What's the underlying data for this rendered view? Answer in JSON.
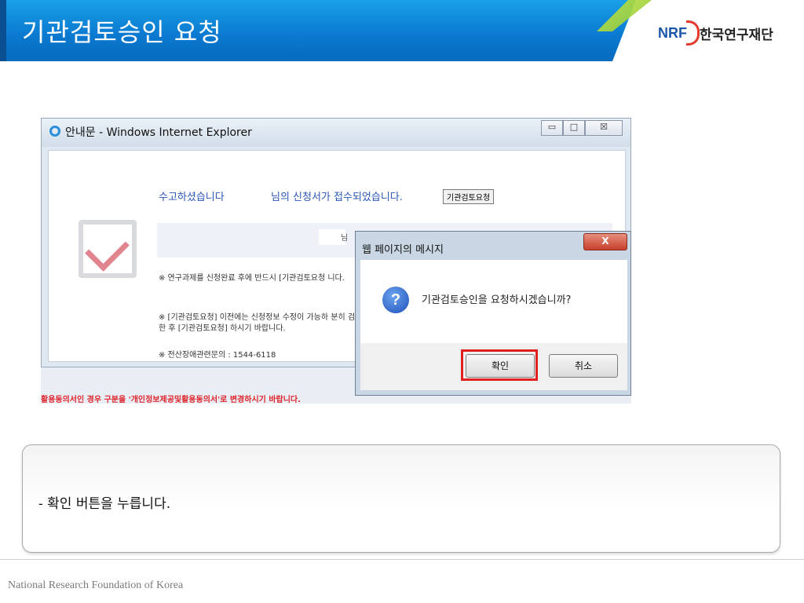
{
  "slide": {
    "title": "기관검토승인 요청",
    "logo": {
      "abbr": "NRF",
      "name": "한국연구재단"
    },
    "caption": "- 확인 버튼을 누릅니다.",
    "footer": "National Research Foundation of Korea"
  },
  "browser": {
    "window_title": "안내문 - Windows Internet Explorer",
    "controls": {
      "minimize": "▭",
      "maximize": "□",
      "close": "☒"
    },
    "content": {
      "thanks": "수고하셨습니다",
      "received": "님의 신청서가 접수되었습니다.",
      "review_button": "기관검토요청",
      "name_suffix": "님",
      "note1": "※ 연구과제를 신청완료 후에 반드시 [기관검토요청 니다.",
      "note2": "※ [기관검토요청] 이전에는 신청정보 수정이 가능하 분히 검토한 후 [기관검토요청] 하시기 바랍니다.",
      "note3": "※ 전산장애관련문의 : 1544-6118"
    },
    "red_notice": "활용동의서인 경우 구분을 '개인정보제공및활용동의서'로 변경하시기 바랍니다."
  },
  "dialog": {
    "title": "웹 페이지의 메시지",
    "close_label": "X",
    "icon": "question-icon",
    "icon_glyph": "?",
    "message": "기관검토승인을 요청하시겠습니까?",
    "ok_label": "확인",
    "cancel_label": "취소"
  },
  "colors": {
    "banner_blue": "#0a78cf",
    "highlight_red": "#e02020",
    "link_blue": "#2a55b5"
  }
}
